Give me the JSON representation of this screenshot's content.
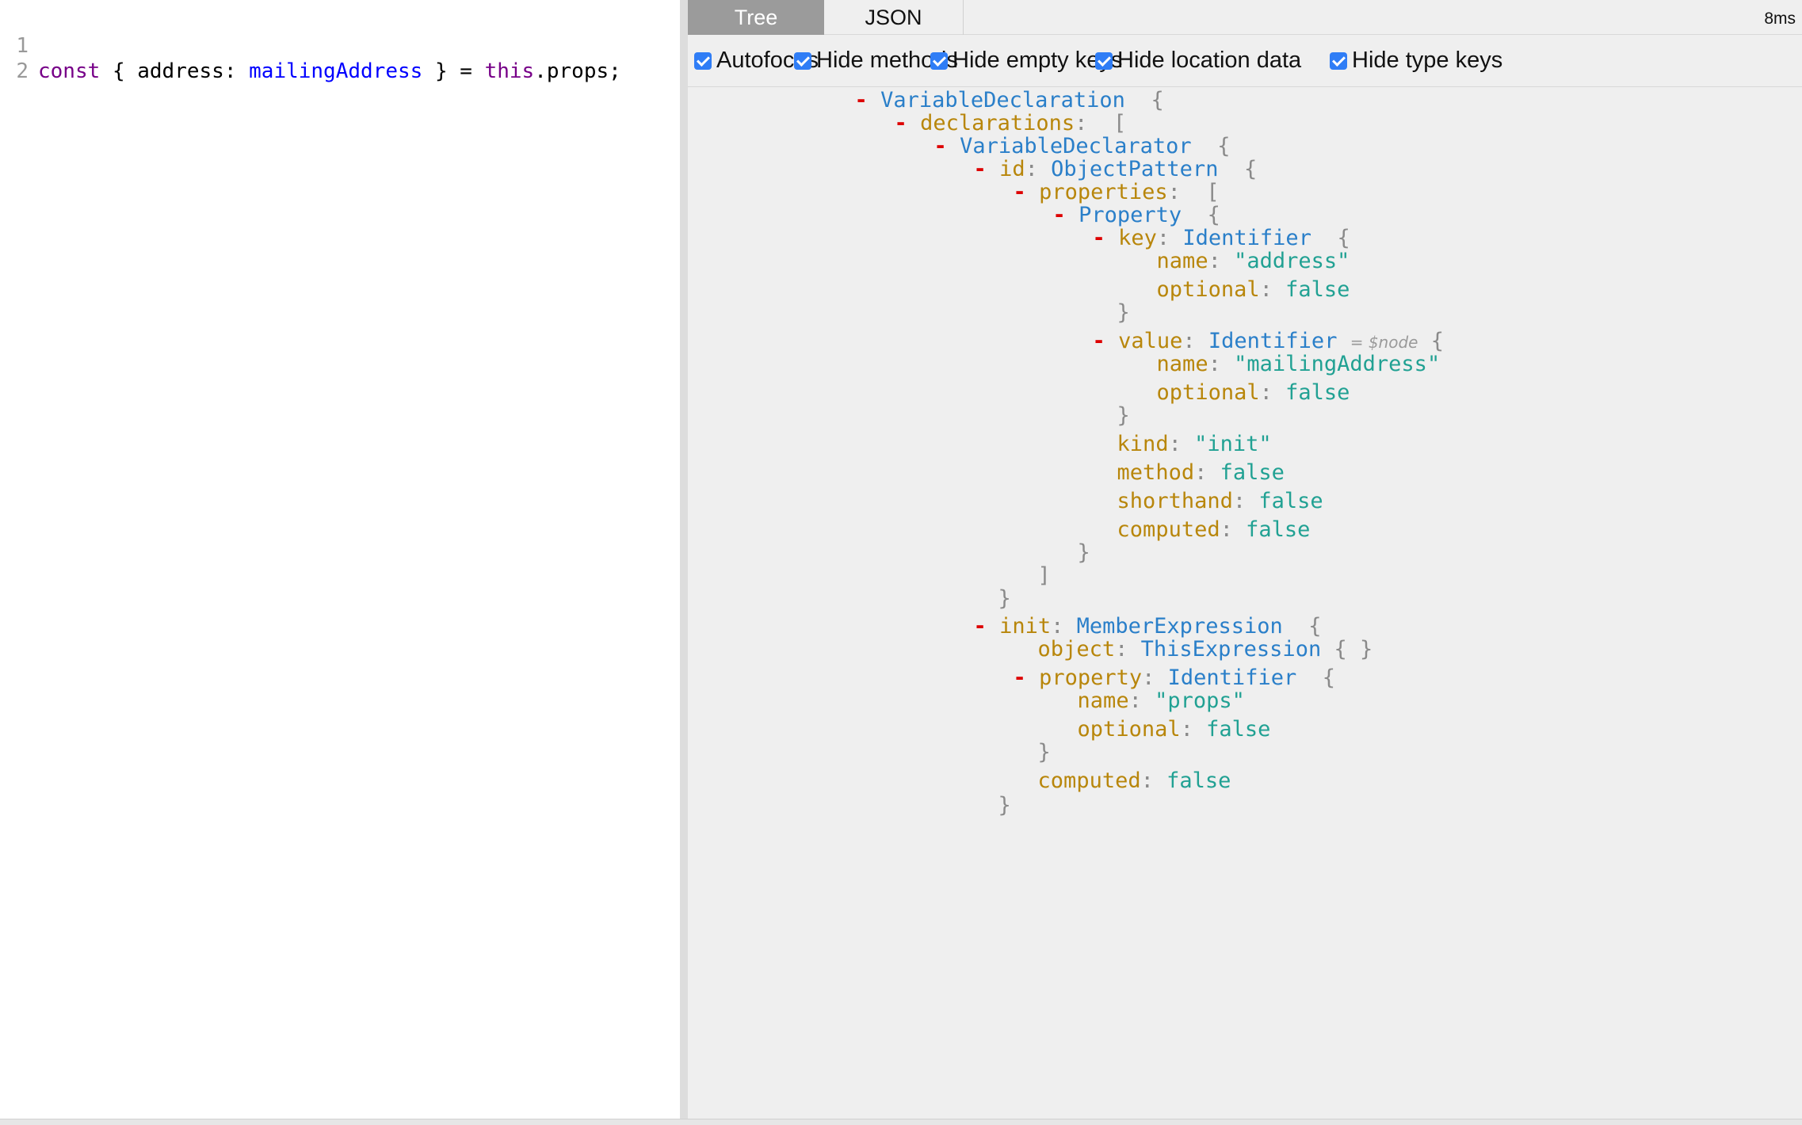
{
  "editor": {
    "lines": [
      {
        "num": "1",
        "tokens": {
          "kw_const": "const",
          "brace_open": "{",
          "key": "address:",
          "alias": "mailingAddress",
          "brace_close": "}",
          "eq": "=",
          "this_kw": "this",
          "rest": ".props;"
        }
      },
      {
        "num": "2"
      }
    ]
  },
  "output": {
    "tabs": {
      "tree": "Tree",
      "json": "JSON"
    },
    "timing": "8ms",
    "options": [
      "Autofocus",
      "Hide methods",
      "Hide empty keys",
      "Hide location data",
      "Hide type keys"
    ],
    "node_tag": "= $node",
    "tree": {
      "toggle": "-",
      "variable_declaration": "VariableDeclaration",
      "declarations_key": "declarations",
      "variable_declarator": "VariableDeclarator",
      "id_key": "id",
      "object_pattern": "ObjectPattern",
      "properties_key": "properties",
      "property_type": "Property",
      "key_key": "key",
      "identifier": "Identifier",
      "name_key": "name",
      "name_address": "\"address\"",
      "optional_key": "optional",
      "false_val": "false",
      "value_key": "value",
      "name_mailing": "\"mailingAddress\"",
      "kind_key": "kind",
      "kind_val": "\"init\"",
      "method_key": "method",
      "shorthand_key": "shorthand",
      "computed_key": "computed",
      "init_key": "init",
      "member_expression": "MemberExpression",
      "object_key": "object",
      "this_expression": "ThisExpression",
      "property_key": "property",
      "name_props": "\"props\"",
      "colon": ":",
      "lbrace": "{",
      "rbrace": "}",
      "lbracket": "[",
      "rbracket": "]",
      "empty_obj": "{ }"
    }
  }
}
